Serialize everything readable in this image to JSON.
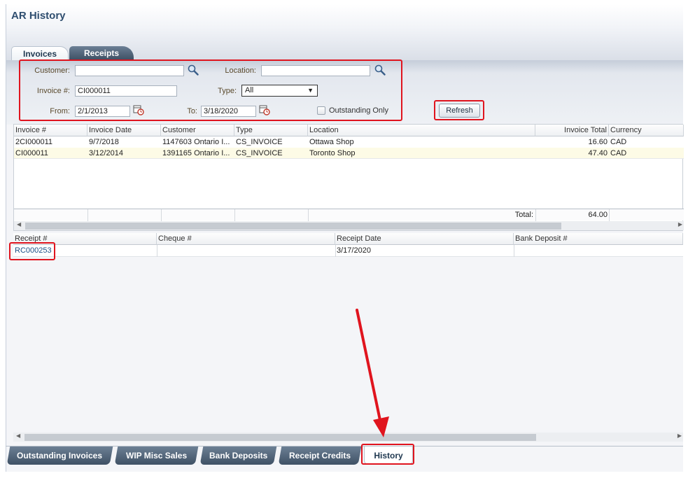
{
  "app": {
    "title": "AR History"
  },
  "top_tabs": [
    {
      "label": "Invoices"
    },
    {
      "label": "Receipts"
    }
  ],
  "filters": {
    "customer_label": "Customer:",
    "customer_value": "",
    "location_label": "Location:",
    "location_value": "",
    "invoice_label": "Invoice #:",
    "invoice_value": "CI000011",
    "type_label": "Type:",
    "type_value": "All",
    "from_label": "From:",
    "from_value": "2/1/2013",
    "to_label": "To:",
    "to_value": "3/18/2020",
    "outstanding_label": "Outstanding Only",
    "outstanding_checked": false,
    "refresh_label": "Refresh"
  },
  "invoices": {
    "columns": [
      "Invoice #",
      "Invoice Date",
      "Customer",
      "Type",
      "Location",
      "Invoice Total",
      "Currency"
    ],
    "rows": [
      [
        "2CI000011",
        "9/7/2018",
        "1147603 Ontario I...",
        "CS_INVOICE",
        "Ottawa Shop",
        "16.60",
        "CAD"
      ],
      [
        "CI000011",
        "3/12/2014",
        "1391165 Ontario I...",
        "CS_INVOICE",
        "Toronto Shop",
        "47.40",
        "CAD"
      ]
    ],
    "total_label": "Total:",
    "total_value": "64.00"
  },
  "receipts": {
    "columns": [
      "Receipt #",
      "Cheque #",
      "Receipt Date",
      "Bank Deposit #"
    ],
    "rows": [
      [
        "RC000253",
        "",
        "3/17/2020",
        ""
      ]
    ]
  },
  "bottom_tabs": [
    {
      "label": "Outstanding Invoices"
    },
    {
      "label": "WIP Misc Sales"
    },
    {
      "label": "Bank Deposits"
    },
    {
      "label": "Receipt Credits"
    },
    {
      "label": "History"
    }
  ],
  "colors": {
    "highlight": "#e0141e",
    "title": "#2f4e6f",
    "tab_dark": "#3f5165",
    "selected_row": "#fdfbe6"
  }
}
